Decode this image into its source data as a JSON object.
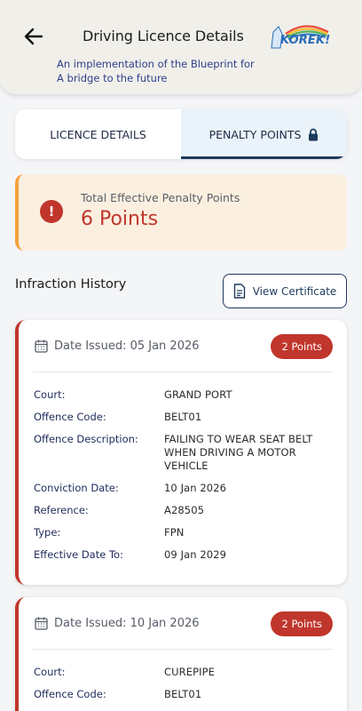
{
  "header": {
    "title": "Driving Licence Details",
    "subtitle": "An implementation of the Blueprint for A bridge to the future",
    "logo_text": "KOREK!",
    "back_icon": "arrow-left-icon"
  },
  "tabs": [
    {
      "label": "LICENCE DETAILS",
      "active": false
    },
    {
      "label": "PENALTY POINTS",
      "active": true,
      "icon": "lock-icon"
    }
  ],
  "summary": {
    "label": "Total Effective Penalty Points",
    "value": "6 Points",
    "icon": "exclamation-icon"
  },
  "history": {
    "title": "Infraction History",
    "certificate_button": "View Certificate"
  },
  "infractions": [
    {
      "date_issued": "Date Issued: 05 Jan 2026",
      "points": "2 Points",
      "fields": [
        {
          "label": "Court:",
          "value": "GRAND PORT"
        },
        {
          "label": "Offence Code:",
          "value": "BELT01"
        },
        {
          "label": "Offence Description:",
          "value": "FAILING TO WEAR SEAT BELT WHEN DRIVING A MOTOR VEHICLE"
        },
        {
          "label": "Conviction Date:",
          "value": "10 Jan 2026"
        },
        {
          "label": "Reference:",
          "value": "A28505"
        },
        {
          "label": "Type:",
          "value": "FPN"
        },
        {
          "label": "Effective Date To:",
          "value": "09 Jan 2029"
        }
      ]
    },
    {
      "date_issued": "Date Issued: 10 Jan 2026",
      "points": "2 Points",
      "fields": [
        {
          "label": "Court:",
          "value": "CUREPIPE"
        },
        {
          "label": "Offence Code:",
          "value": "BELT01"
        }
      ]
    }
  ],
  "colors": {
    "accent_red": "#c0362c",
    "navy": "#1d3a5c",
    "summary_bg": "#fbefe0",
    "summary_border": "#f2a23d"
  }
}
